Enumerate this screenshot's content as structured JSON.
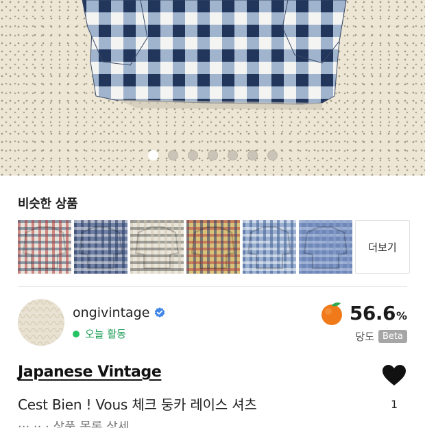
{
  "hero": {
    "pagination": {
      "total": 7,
      "active_index": 0
    }
  },
  "similar": {
    "title": "비슷한 상품",
    "more_label": "더보기",
    "items": [
      {
        "name": "red-plaid-shirt",
        "colors": [
          "#b73a3a",
          "#2f4f6f",
          "#e8e2d8"
        ]
      },
      {
        "name": "navy-check-shirt",
        "colors": [
          "#27385e",
          "#f2f2f2",
          "#6e7fa3"
        ]
      },
      {
        "name": "cream-check-shirt",
        "colors": [
          "#cfc7b4",
          "#555555",
          "#ebe6da"
        ]
      },
      {
        "name": "multicolor-plaid-shirt",
        "colors": [
          "#2c3d6b",
          "#b23b3b",
          "#d9c17a"
        ]
      },
      {
        "name": "blue-gingham-shirt",
        "colors": [
          "#3c5c92",
          "#ffffff",
          "#9bb0d0"
        ]
      },
      {
        "name": "light-blue-shirt",
        "colors": [
          "#8aa2cf",
          "#c7d4ea",
          "#6f88b8"
        ]
      }
    ]
  },
  "seller": {
    "name": "ongivintage",
    "status": "오늘 활동",
    "sweetness_value": "56.6",
    "sweetness_unit": "%",
    "sweetness_label": "당도",
    "beta_label": "Beta"
  },
  "product": {
    "brand": "Japanese Vintage",
    "title": "Cest Bien ! Vous 체크 둥카 레이스 셔츠",
    "like_count": "1",
    "next_line_partial": "··· ·· · 상품 목록 상세"
  },
  "colors": {
    "accent_green": "#26c266",
    "verified_blue": "#3f86e6",
    "orange": "#f07a1a",
    "beta_gray": "#a6a6a6"
  }
}
